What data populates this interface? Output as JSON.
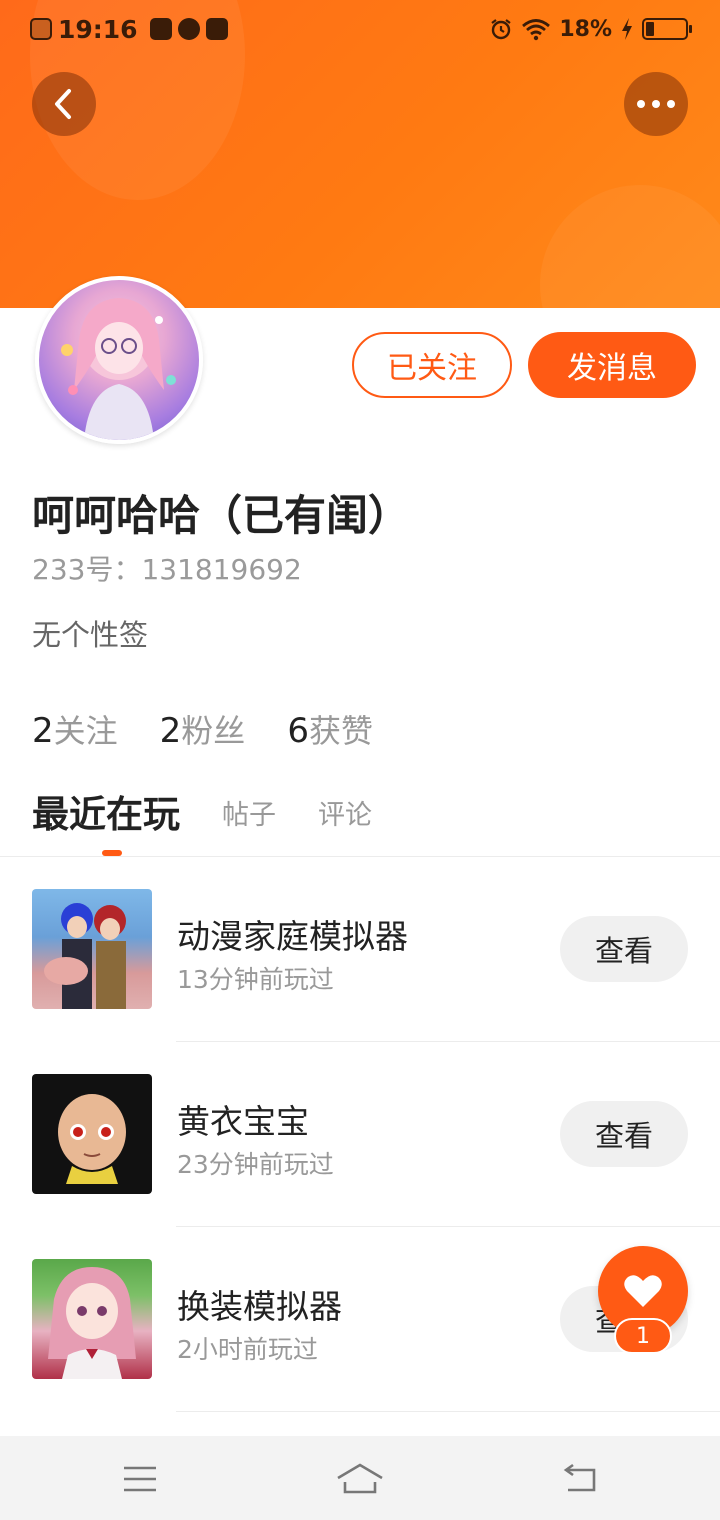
{
  "status_bar": {
    "time": "19:16",
    "battery_percent": "18%",
    "battery_level": 0.18,
    "icons": [
      "sim-off-icon",
      "mail-icon",
      "app-icon",
      "app-icon",
      "alarm-icon",
      "wifi-icon",
      "charging-icon",
      "battery-icon"
    ]
  },
  "header": {
    "back_icon": "chevron-left-icon",
    "more_icon": "more-dots-icon"
  },
  "profile": {
    "name": "呵呵哈哈（已有闺）",
    "id_label": "233号：131819692",
    "signature": "无个性签",
    "follow_button": "已关注",
    "message_button": "发消息",
    "stats": [
      {
        "num": "2",
        "label": "关注"
      },
      {
        "num": "2",
        "label": "粉丝"
      },
      {
        "num": "6",
        "label": "获赞"
      }
    ]
  },
  "tabs": [
    "最近在玩",
    "帖子",
    "评论"
  ],
  "games": [
    {
      "title": "动漫家庭模拟器",
      "subtitle": "13分钟前玩过",
      "action": "查看"
    },
    {
      "title": "黄衣宝宝",
      "subtitle": "23分钟前玩过",
      "action": "查看"
    },
    {
      "title": "换装模拟器",
      "subtitle": "2小时前玩过",
      "action": "查看"
    }
  ],
  "fab": {
    "icon": "heart-icon",
    "count": "1"
  },
  "navbar": [
    "menu-icon",
    "home-icon",
    "back-icon"
  ],
  "colors": {
    "accent": "#ff5a14",
    "header": "#ff7a12"
  }
}
